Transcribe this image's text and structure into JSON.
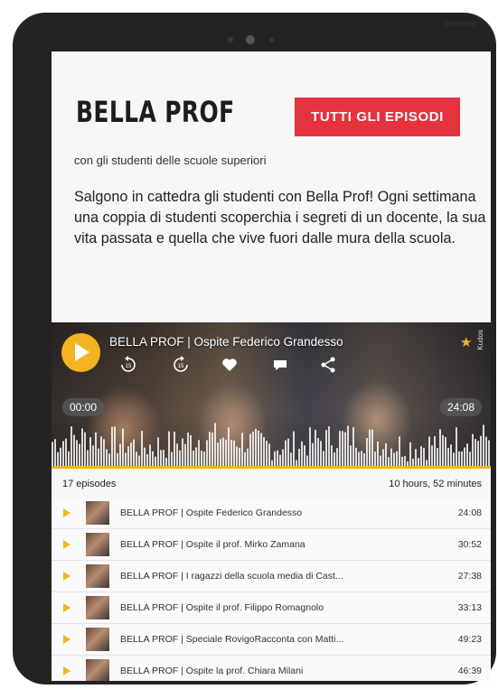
{
  "page": {
    "title": "BELLA PROF",
    "cta_label": "TUTTI GLI EPISODI",
    "subtitle": "con gli studenti delle scuole superiori",
    "description": "Salgono in cattedra gli studenti con Bella Prof! Ogni settimana una coppia di studenti scoperchia i segreti di un docente, la sua vita passata e quella che vive fuori dalle mura della scuola."
  },
  "player": {
    "episode_title": "BELLA PROF | Ospite Federico Grandesso",
    "elapsed": "00:00",
    "total": "24:08",
    "brand_vertical": "Kudos",
    "accent_color": "#f2b521",
    "controls": [
      "play-icon",
      "rewind-icon",
      "forward-icon",
      "heart-icon",
      "comment-icon",
      "share-icon",
      "star-icon"
    ]
  },
  "playlist": {
    "count_label": "17 episodes",
    "total_label": "10 hours, 52 minutes",
    "episodes": [
      {
        "title": "BELLA PROF | Ospite Federico Grandesso",
        "length": "24:08"
      },
      {
        "title": "BELLA PROF | Ospite il prof. Mirko Zamana",
        "length": "30:52"
      },
      {
        "title": "BELLA PROF | I ragazzi della scuola media di Cast...",
        "length": "27:38"
      },
      {
        "title": "BELLA PROF | Ospite il prof. Filippo Romagnolo",
        "length": "33:13"
      },
      {
        "title": "BELLA PROF | Speciale RovigoRacconta con Matti...",
        "length": "49:23"
      },
      {
        "title": "BELLA PROF | Ospite la prof. Chiara Milani",
        "length": "46:39"
      }
    ]
  },
  "colors": {
    "cta_red": "#e6323f",
    "frame": "#232323"
  }
}
